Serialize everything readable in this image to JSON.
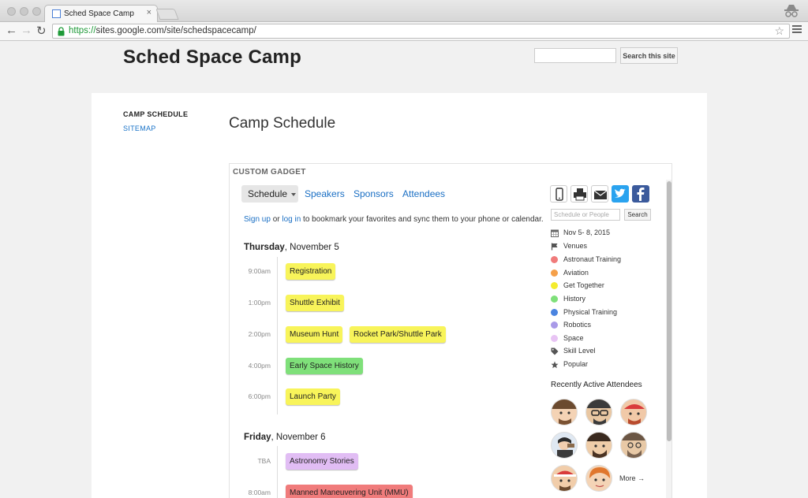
{
  "browser": {
    "tab_title": "Sched Space Camp",
    "tab_close": "×",
    "url_scheme": "https://",
    "url_rest": "sites.google.com/site/schedspacecamp/",
    "back": "←",
    "forward": "→",
    "reload": "↻",
    "star": "☆"
  },
  "site": {
    "title": "Sched Space Camp",
    "search_button": "Search this site",
    "nav_active": "CAMP SCHEDULE",
    "nav_link": "SITEMAP",
    "page_heading": "Camp Schedule"
  },
  "gadget": {
    "label": "CUSTOM GADGET",
    "tabs": {
      "schedule": "Schedule",
      "speakers": "Speakers",
      "sponsors": "Sponsors",
      "attendees": "Attendees"
    },
    "signup": {
      "sign_up": "Sign up",
      "or": " or ",
      "log_in": "log in",
      "rest": " to bookmark your favorites and sync them to your phone or calendar."
    },
    "days": [
      {
        "weekday": "Thursday",
        "date": ", November 5"
      },
      {
        "weekday": "Friday",
        "date": ", November 6"
      }
    ],
    "times": [
      "9:00am",
      "1:00pm",
      "2:00pm",
      "4:00pm",
      "6:00pm",
      "TBA",
      "8:00am"
    ],
    "events": [
      "Registration",
      "Shuttle Exhibit",
      "Museum Hunt",
      "Rocket Park/Shuttle Park",
      "Early Space History",
      "Launch Party",
      "Astronomy Stories",
      "Manned Maneuvering Unit (MMU)"
    ],
    "search_placeholder": "Schedule or People",
    "search_button": "Search",
    "date_range": "Nov 5- 8, 2015",
    "categories": [
      {
        "label": "Venues",
        "color": ""
      },
      {
        "label": "Astronaut Training",
        "color": "#f07b7b"
      },
      {
        "label": "Aviation",
        "color": "#f5a04a"
      },
      {
        "label": "Get Together",
        "color": "#f4ec2e"
      },
      {
        "label": "History",
        "color": "#7fe07a"
      },
      {
        "label": "Physical Training",
        "color": "#4a84e0"
      },
      {
        "label": "Robotics",
        "color": "#a99ae8"
      },
      {
        "label": "Space",
        "color": "#e8c4f4"
      },
      {
        "label": "Skill Level",
        "color": ""
      },
      {
        "label": "Popular",
        "color": ""
      }
    ],
    "attendees_title": "Recently Active Attendees",
    "more": "More →",
    "colors": {
      "yellow": "#f8f45a",
      "green": "#7fe07a",
      "lavender": "#e1bdf4",
      "salmon": "#f07b7b"
    }
  }
}
